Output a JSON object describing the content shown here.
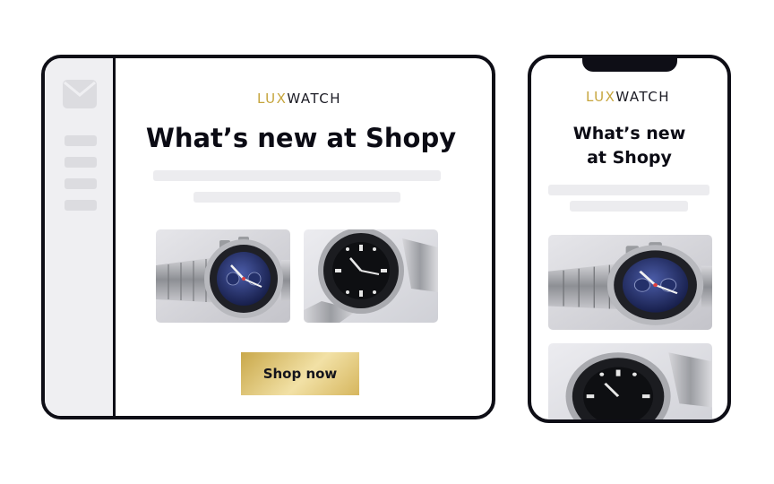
{
  "desktop": {
    "brand": {
      "part1": "LUX",
      "part2": "WATCH"
    },
    "title": "What’s new at Shopy",
    "button_label": "Shop now"
  },
  "phone": {
    "brand": {
      "part1": "LUX",
      "part2": "WATCH"
    },
    "title_line1": "What’s new",
    "title_line2": "at Shopy"
  },
  "icons": {
    "sidebar": "mail-icon"
  },
  "colors": {
    "gold": "#c6a53d",
    "frame": "#0e0e16",
    "button_gold": "#d9bd6a"
  }
}
